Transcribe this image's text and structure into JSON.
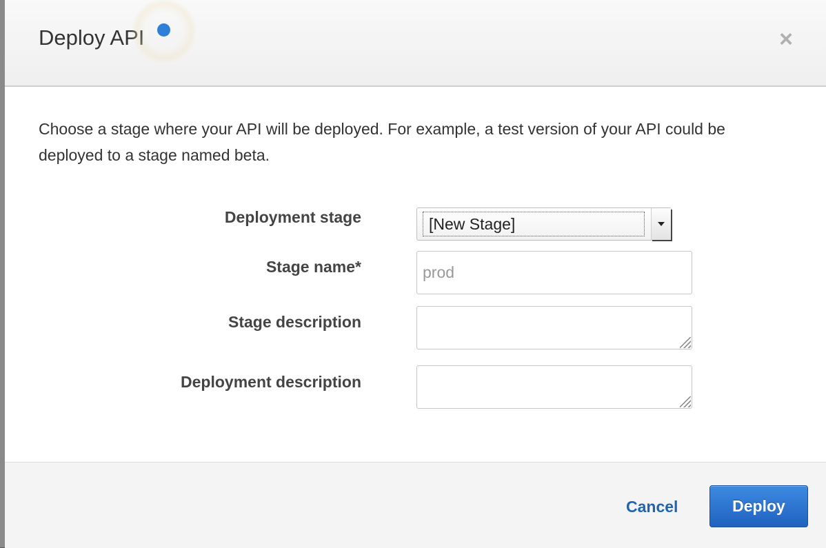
{
  "dialog": {
    "title": "Deploy API",
    "close_label": "×"
  },
  "body": {
    "intro": "Choose a stage where your API will be deployed. For example, a test version of your API could be deployed to a stage named beta."
  },
  "form": {
    "deployment_stage": {
      "label": "Deployment stage",
      "selected": "[New Stage]"
    },
    "stage_name": {
      "label": "Stage name*",
      "value": "",
      "placeholder": "prod"
    },
    "stage_description": {
      "label": "Stage description",
      "value": ""
    },
    "deployment_description": {
      "label": "Deployment description",
      "value": ""
    }
  },
  "footer": {
    "cancel_label": "Cancel",
    "deploy_label": "Deploy"
  },
  "colors": {
    "primary": "#2f7fd8",
    "link": "#1f64b0",
    "status_dot": "#2f7fd8"
  },
  "icons": {
    "close": "close-icon",
    "select_arrow": "chevron-down-icon",
    "resize_grip": "resize-grip-icon"
  }
}
